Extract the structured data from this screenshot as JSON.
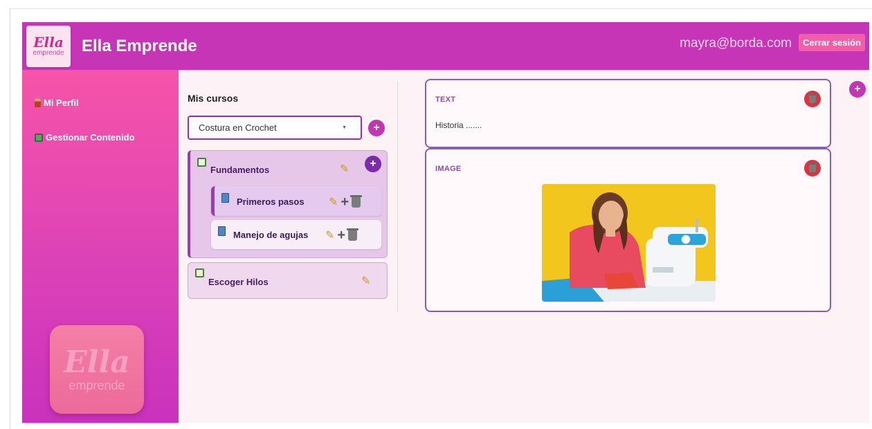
{
  "header": {
    "logo_main": "Ella",
    "logo_sub": "emprende",
    "title": "Ella Emprende",
    "user_email": "mayra@borda.com",
    "logout_label": "Cerrar sesión"
  },
  "sidebar": {
    "items": [
      {
        "label": "Mi Perfil",
        "icon": "person-icon"
      },
      {
        "label": "Gestionar Contenido",
        "icon": "book-icon"
      }
    ],
    "logo_main": "Ella",
    "logo_sub": "emprende"
  },
  "courses": {
    "title": "Mis cursos",
    "selected_course": "Costura en Crochet",
    "add_label": "+",
    "modules": [
      {
        "title": "Fundamentos",
        "expanded": true,
        "add_label": "+",
        "lessons": [
          {
            "title": "Primeros pasos",
            "active": true
          },
          {
            "title": "Manejo de agujas",
            "active": false
          }
        ]
      },
      {
        "title": "Escoger Hilos",
        "expanded": false,
        "lessons": []
      }
    ]
  },
  "content_blocks": [
    {
      "type": "TEXT",
      "text": "Historia ......."
    },
    {
      "type": "IMAGE",
      "image": "woman-sewing-machine-photo"
    }
  ],
  "add_block_label": "+",
  "colors": {
    "header": "#c535b5",
    "sidebar_top": "#f654a8",
    "accent": "#c235b3",
    "delete": "#e0313f",
    "logout": "#f25fa9"
  }
}
